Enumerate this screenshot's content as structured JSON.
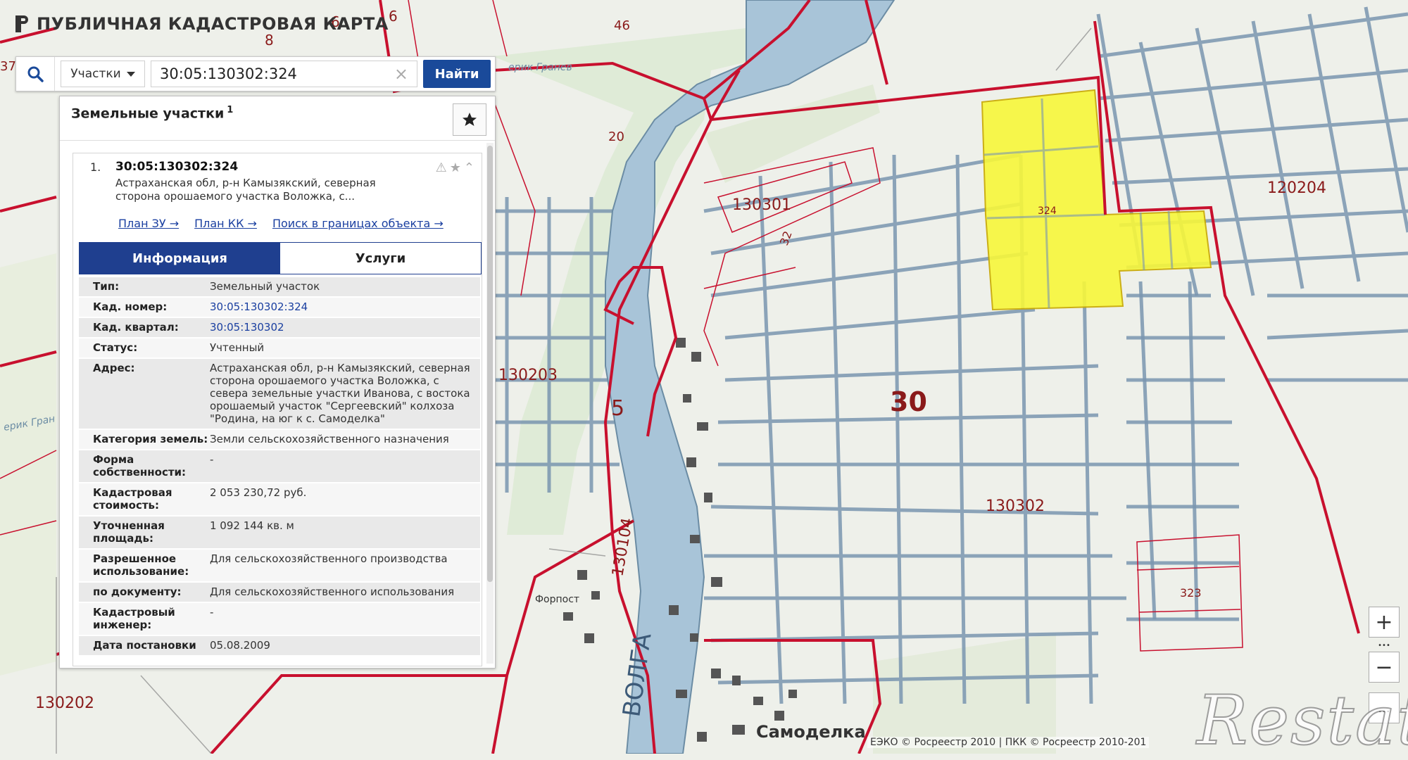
{
  "app": {
    "title": "ПУБЛИЧНАЯ КАДАСТРОВАЯ КАРТА"
  },
  "search": {
    "type_selected": "Участки",
    "query": "30:05:130302:324",
    "find_label": "Найти"
  },
  "panel": {
    "title": "Земельные участки",
    "title_count": "1",
    "result": {
      "index": "1.",
      "cad_number": "30:05:130302:324",
      "address_short": "Астраханская обл, р-н Камызякский, северная сторона орошаемого участка Воложка, с...",
      "links": [
        "План ЗУ →",
        "План КК →",
        "Поиск в границах объекта →"
      ],
      "tabs": [
        "Информация",
        "Услуги"
      ],
      "props": [
        {
          "label": "Тип:",
          "value": "Земельный участок"
        },
        {
          "label": "Кад. номер:",
          "value": "30:05:130302:324"
        },
        {
          "label": "Кад. квартал:",
          "value": "30:05:130302"
        },
        {
          "label": "Статус:",
          "value": "Учтенный"
        },
        {
          "label": "Адрес:",
          "value": "Астраханская обл, р-н Камызякский, северная сторона орошаемого участка Воложка, с севера земельные участки Иванова, с востока орошаемый участок \"Сергеевский\" колхоза \"Родина, на юг к с. Самоделка\""
        },
        {
          "label": "Категория земель:",
          "value": "Земли сельскохозяйственного назначения"
        },
        {
          "label": "Форма собственности:",
          "value": "-"
        },
        {
          "label": "Кадастровая стоимость:",
          "value": "2 053 230,72 руб."
        },
        {
          "label": "Уточненная площадь:",
          "value": "1 092 144 кв. м"
        },
        {
          "label": "Разрешенное использование:",
          "value": "Для сельскохозяйственного производства"
        },
        {
          "label": "по документу:",
          "value": "Для сельскохозяйственного использования"
        },
        {
          "label": "Кадастровый инженер:",
          "value": "-"
        },
        {
          "label": "Дата постановки",
          "value": "05.08.2009"
        }
      ]
    }
  },
  "map": {
    "labels": {
      "l6a": "6",
      "l6b": "6",
      "l8": "8",
      "l46": "46",
      "l37": "37",
      "l20": "20",
      "l130301": "130301",
      "l32": "32",
      "l324": "324",
      "l120204": "120204",
      "l130203": "130203",
      "l5": "5",
      "l30": "30",
      "l130302": "130302",
      "l130104": "130104",
      "l323": "323",
      "l130202": "130202",
      "volga": "ВОЛГА",
      "samodelka": "Самоделка",
      "forpost": "Форпост",
      "erik_granev": "ерик Гранев",
      "erik_gr2": "ерик Гран"
    }
  },
  "controls": {
    "zoom_in": "+",
    "zoom_out": "−",
    "more": "..."
  },
  "attribution": "ЕЭКО © Росреестр 2010 | ПКК © Росреестр 2010-201",
  "watermark": "Restate",
  "colors": {
    "boundary": "#c8102e",
    "parcel": "#f7f73a",
    "canal": "#7a96b0",
    "river": "#a8c4d8",
    "accent": "#1f3f8f"
  }
}
